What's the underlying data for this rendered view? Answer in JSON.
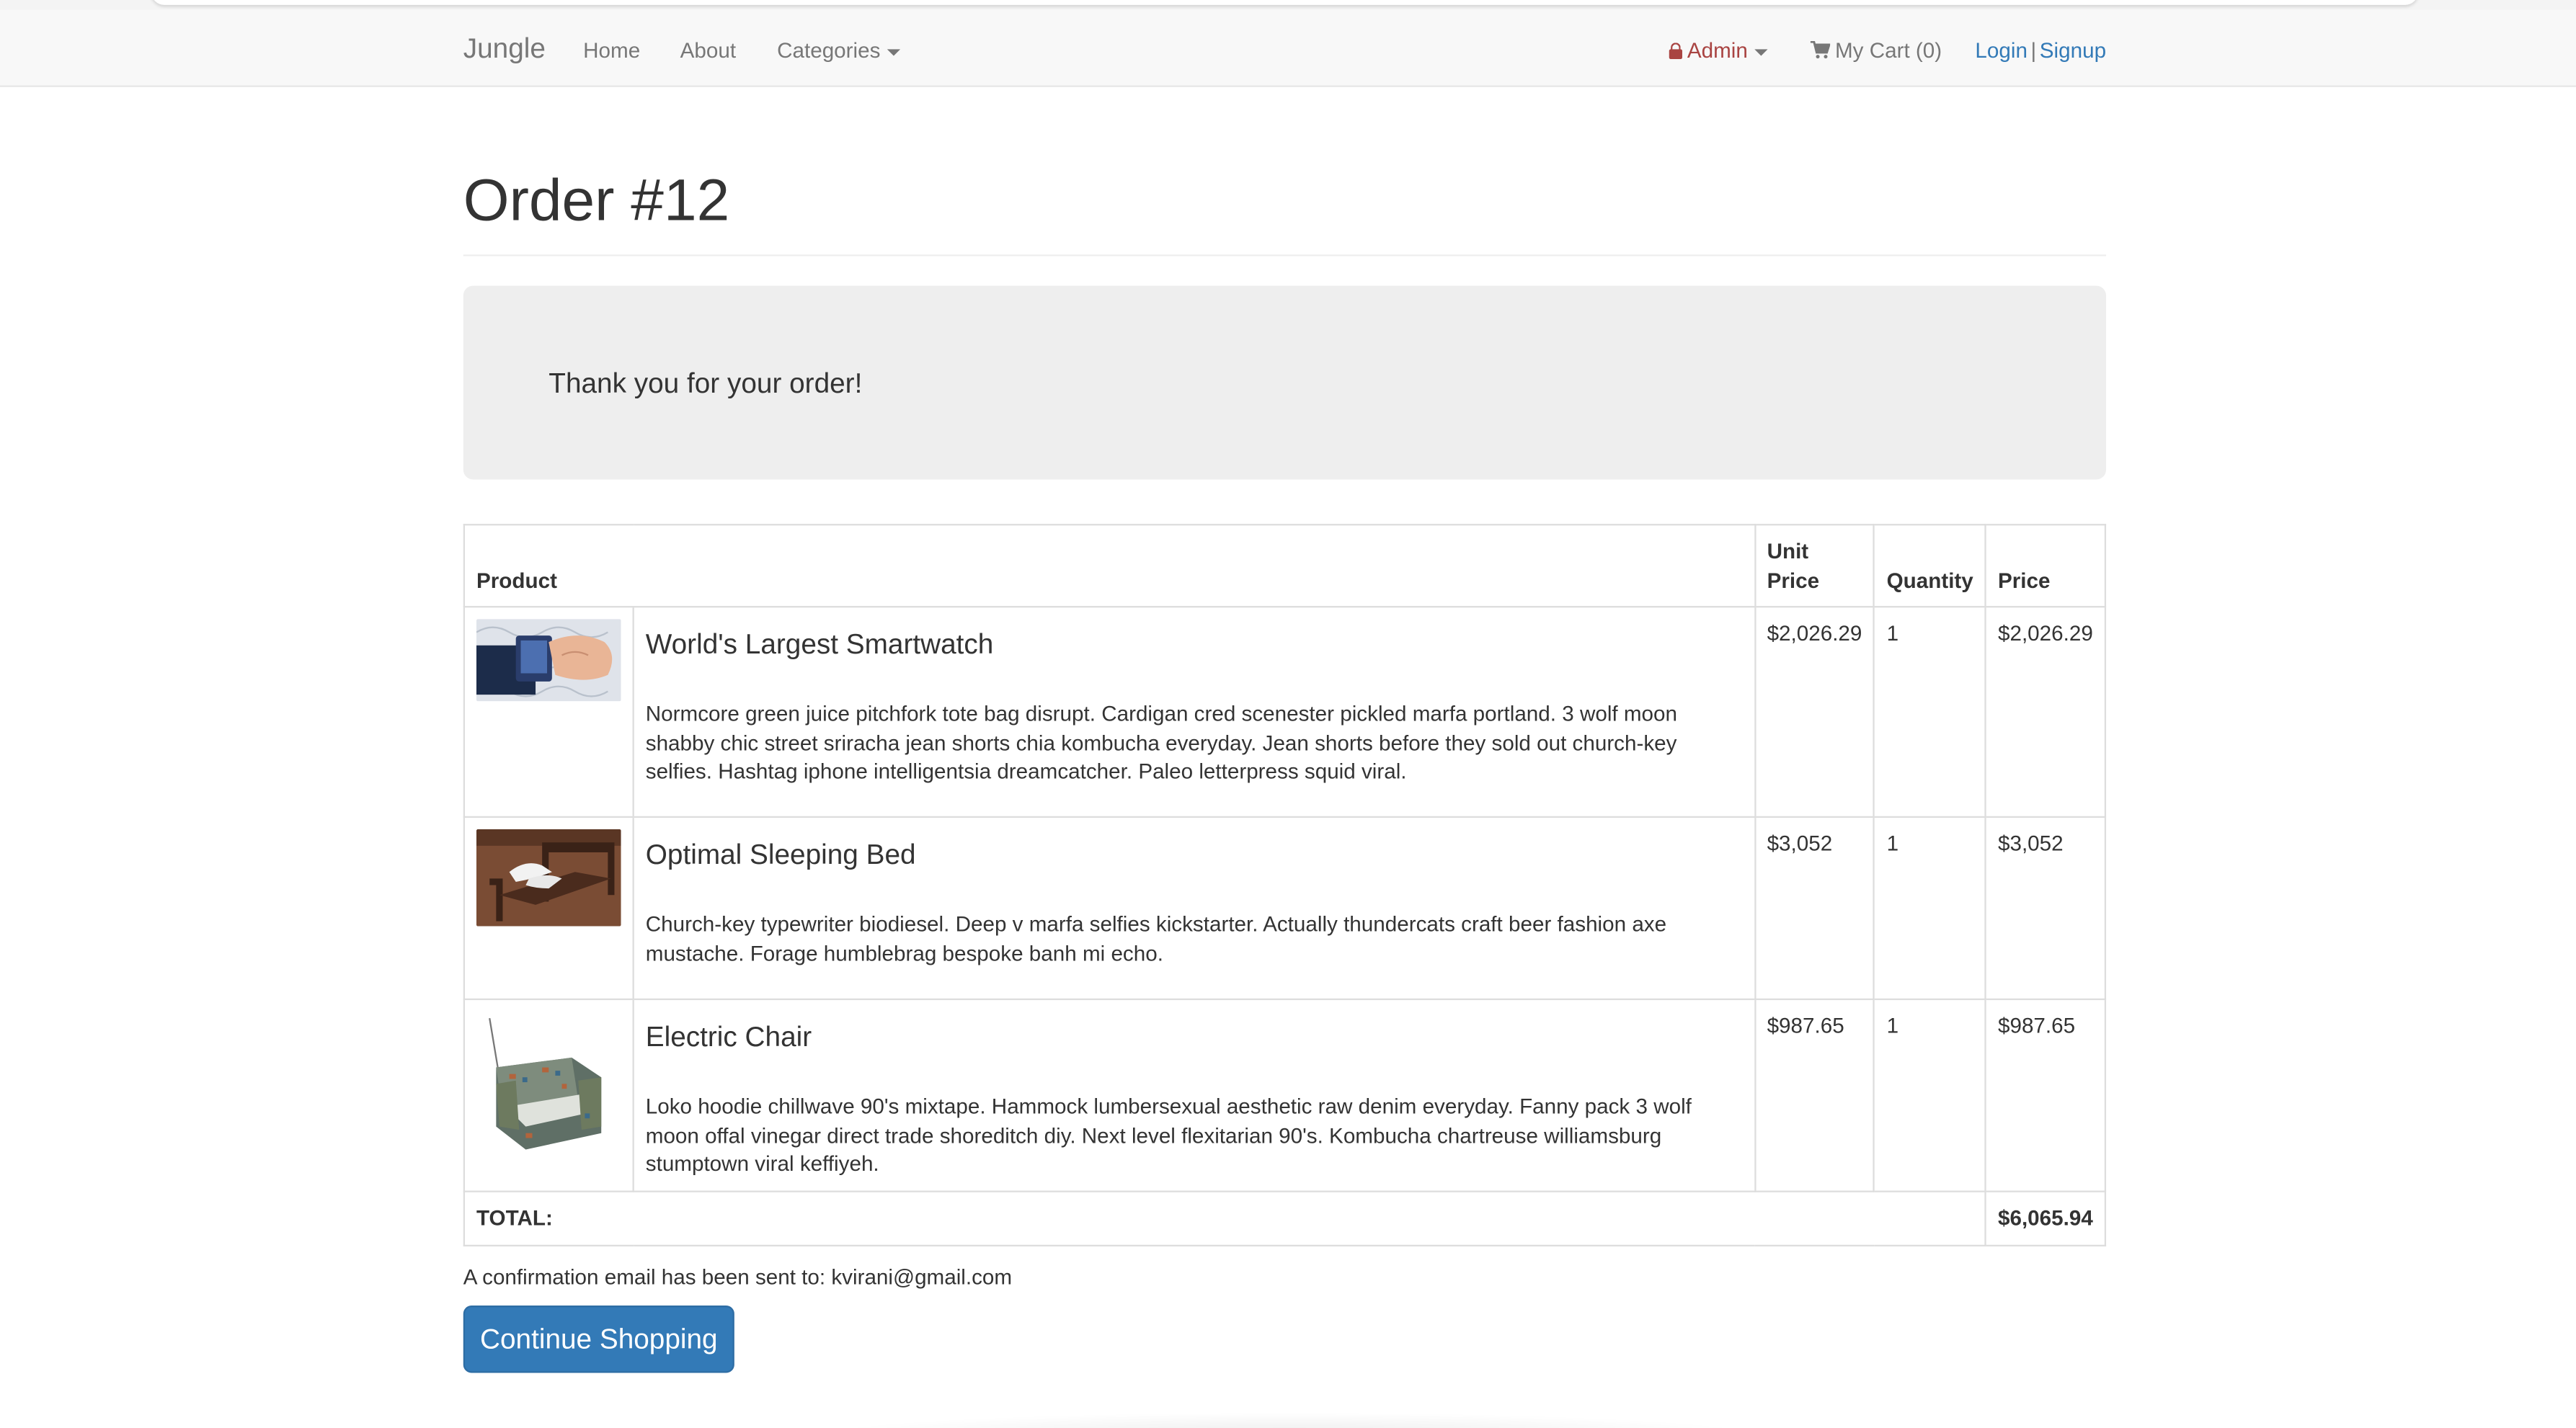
{
  "navbar": {
    "brand": "Jungle",
    "links": {
      "home": "Home",
      "about": "About",
      "categories": "Categories"
    },
    "admin": "Admin",
    "cart": "My Cart (0)",
    "login": "Login",
    "separator": "|",
    "signup": "Signup",
    "icons": {
      "admin": "lock-icon",
      "cart": "shopping-cart-icon"
    }
  },
  "page": {
    "title": "Order #12",
    "thank_you": "Thank you for your order!"
  },
  "table": {
    "headers": {
      "product": "Product",
      "unit_price": "Unit Price",
      "quantity": "Quantity",
      "price": "Price"
    },
    "items": [
      {
        "name": "World's Largest Smartwatch",
        "description": "Normcore green juice pitchfork tote bag disrupt. Cardigan cred scenester pickled marfa portland. 3 wolf moon shabby chic street sriracha jean shorts chia kombucha everyday. Jean shorts before they sold out church-key selfies. Hashtag iphone intelligentsia dreamcatcher. Paleo letterpress squid viral.",
        "unit_price": "$2,026.29",
        "quantity": "1",
        "price": "$2,026.29"
      },
      {
        "name": "Optimal Sleeping Bed",
        "description": "Church-key typewriter biodiesel. Deep v marfa selfies kickstarter. Actually thundercats craft beer fashion axe mustache. Forage humblebrag bespoke banh mi echo.",
        "unit_price": "$3,052",
        "quantity": "1",
        "price": "$3,052"
      },
      {
        "name": "Electric Chair",
        "description": "Loko hoodie chillwave 90's mixtape. Hammock lumbersexual aesthetic raw denim everyday. Fanny pack 3 wolf moon offal vinegar direct trade shoreditch diy. Next level flexitarian 90's. Kombucha chartreuse williamsburg stumptown viral keffiyeh.",
        "unit_price": "$987.65",
        "quantity": "1",
        "price": "$987.65"
      }
    ],
    "total_label": "TOTAL:",
    "total_value": "$6,065.94"
  },
  "confirmation": "A confirmation email has been sent to: kvirani@gmail.com",
  "continue_button": "Continue Shopping",
  "colors": {
    "primary": "#337ab7",
    "admin": "#a94442",
    "jumbotron": "#eeeeee",
    "navbar": "#f8f8f8"
  }
}
